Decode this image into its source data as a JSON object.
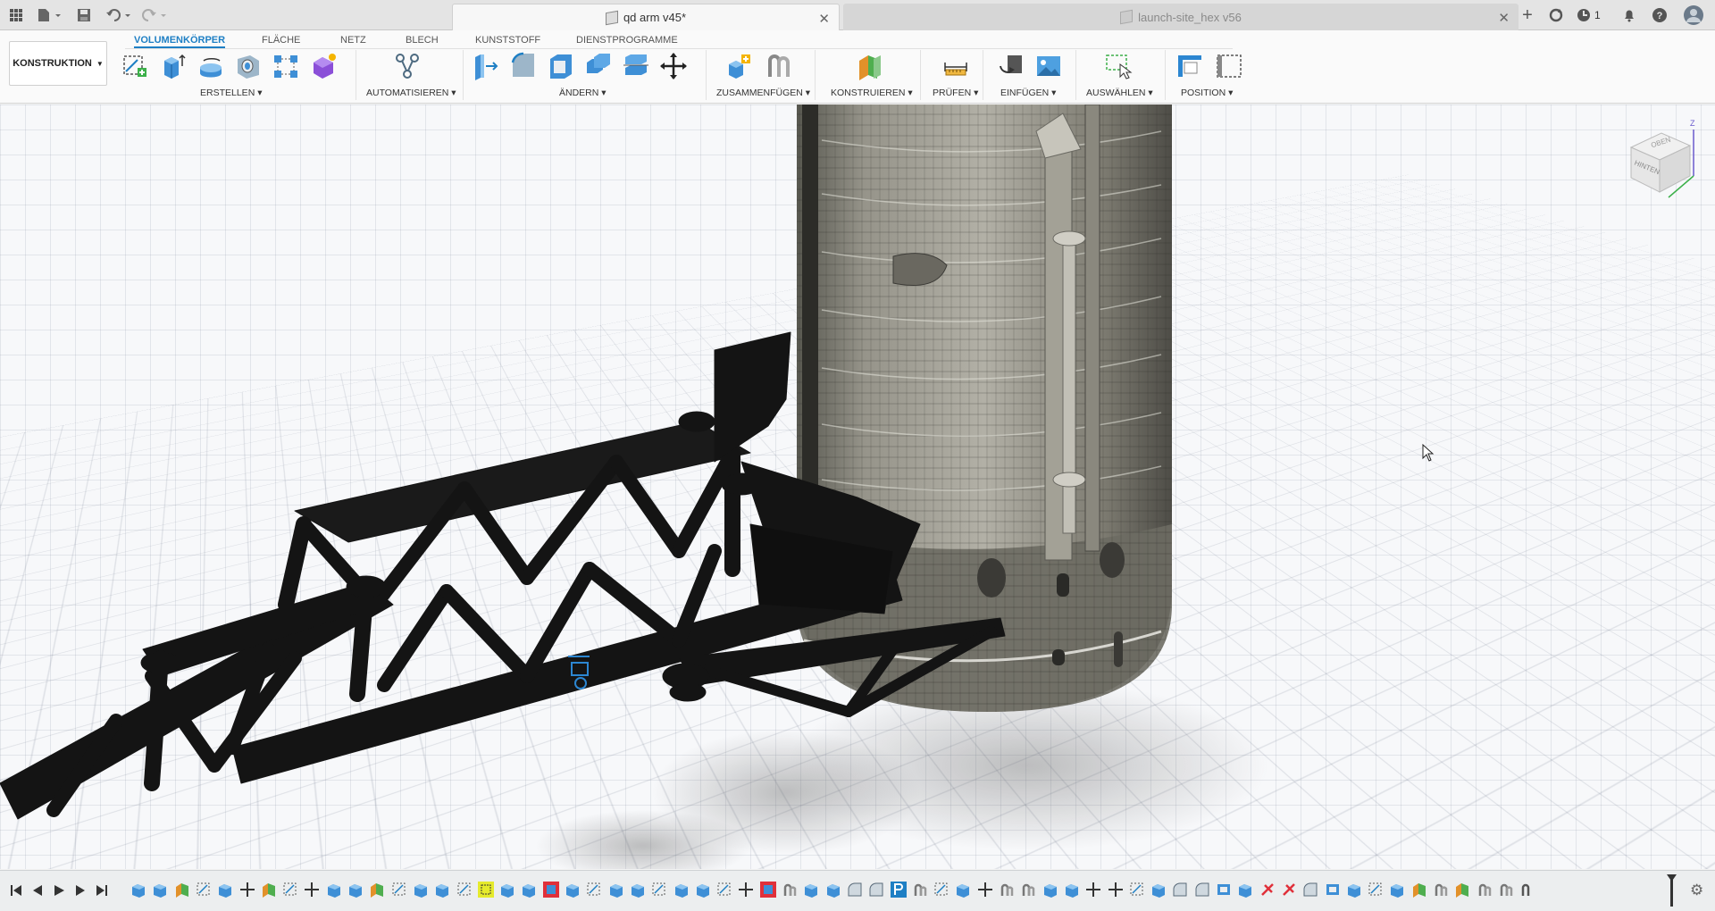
{
  "titlebar": {
    "active_tab": "qd arm v45*",
    "inactive_tab": "launch-site_hex v56",
    "notification_count": "1"
  },
  "toolbar": {
    "workspace": "KONSTRUKTION",
    "tabs": [
      "VOLUMENKÖRPER",
      "FLÄCHE",
      "NETZ",
      "BLECH",
      "KUNSTSTOFF",
      "DIENSTPROGRAMME"
    ],
    "active_tab_index": 0,
    "groups": {
      "erstellen": "ERSTELLEN",
      "automatisieren": "AUTOMATISIEREN",
      "aendern": "ÄNDERN",
      "zusammenfuegen": "ZUSAMMENFÜGEN",
      "konstruieren": "KONSTRUIEREN",
      "pruefen": "PRÜFEN",
      "einfuegen": "EINFÜGEN",
      "auswaehlen": "AUSWÄHLEN",
      "position": "POSITION"
    }
  },
  "viewcube": {
    "face_front": "HINTEN",
    "face_top": "OBEN",
    "axis_z": "Z"
  },
  "colors": {
    "accent": "#1e7fc4",
    "truss": "#141414",
    "tank": "#8c8a80",
    "timeline_highlight_yellow": "#e5ea2c",
    "timeline_highlight_red": "#e0303a"
  }
}
